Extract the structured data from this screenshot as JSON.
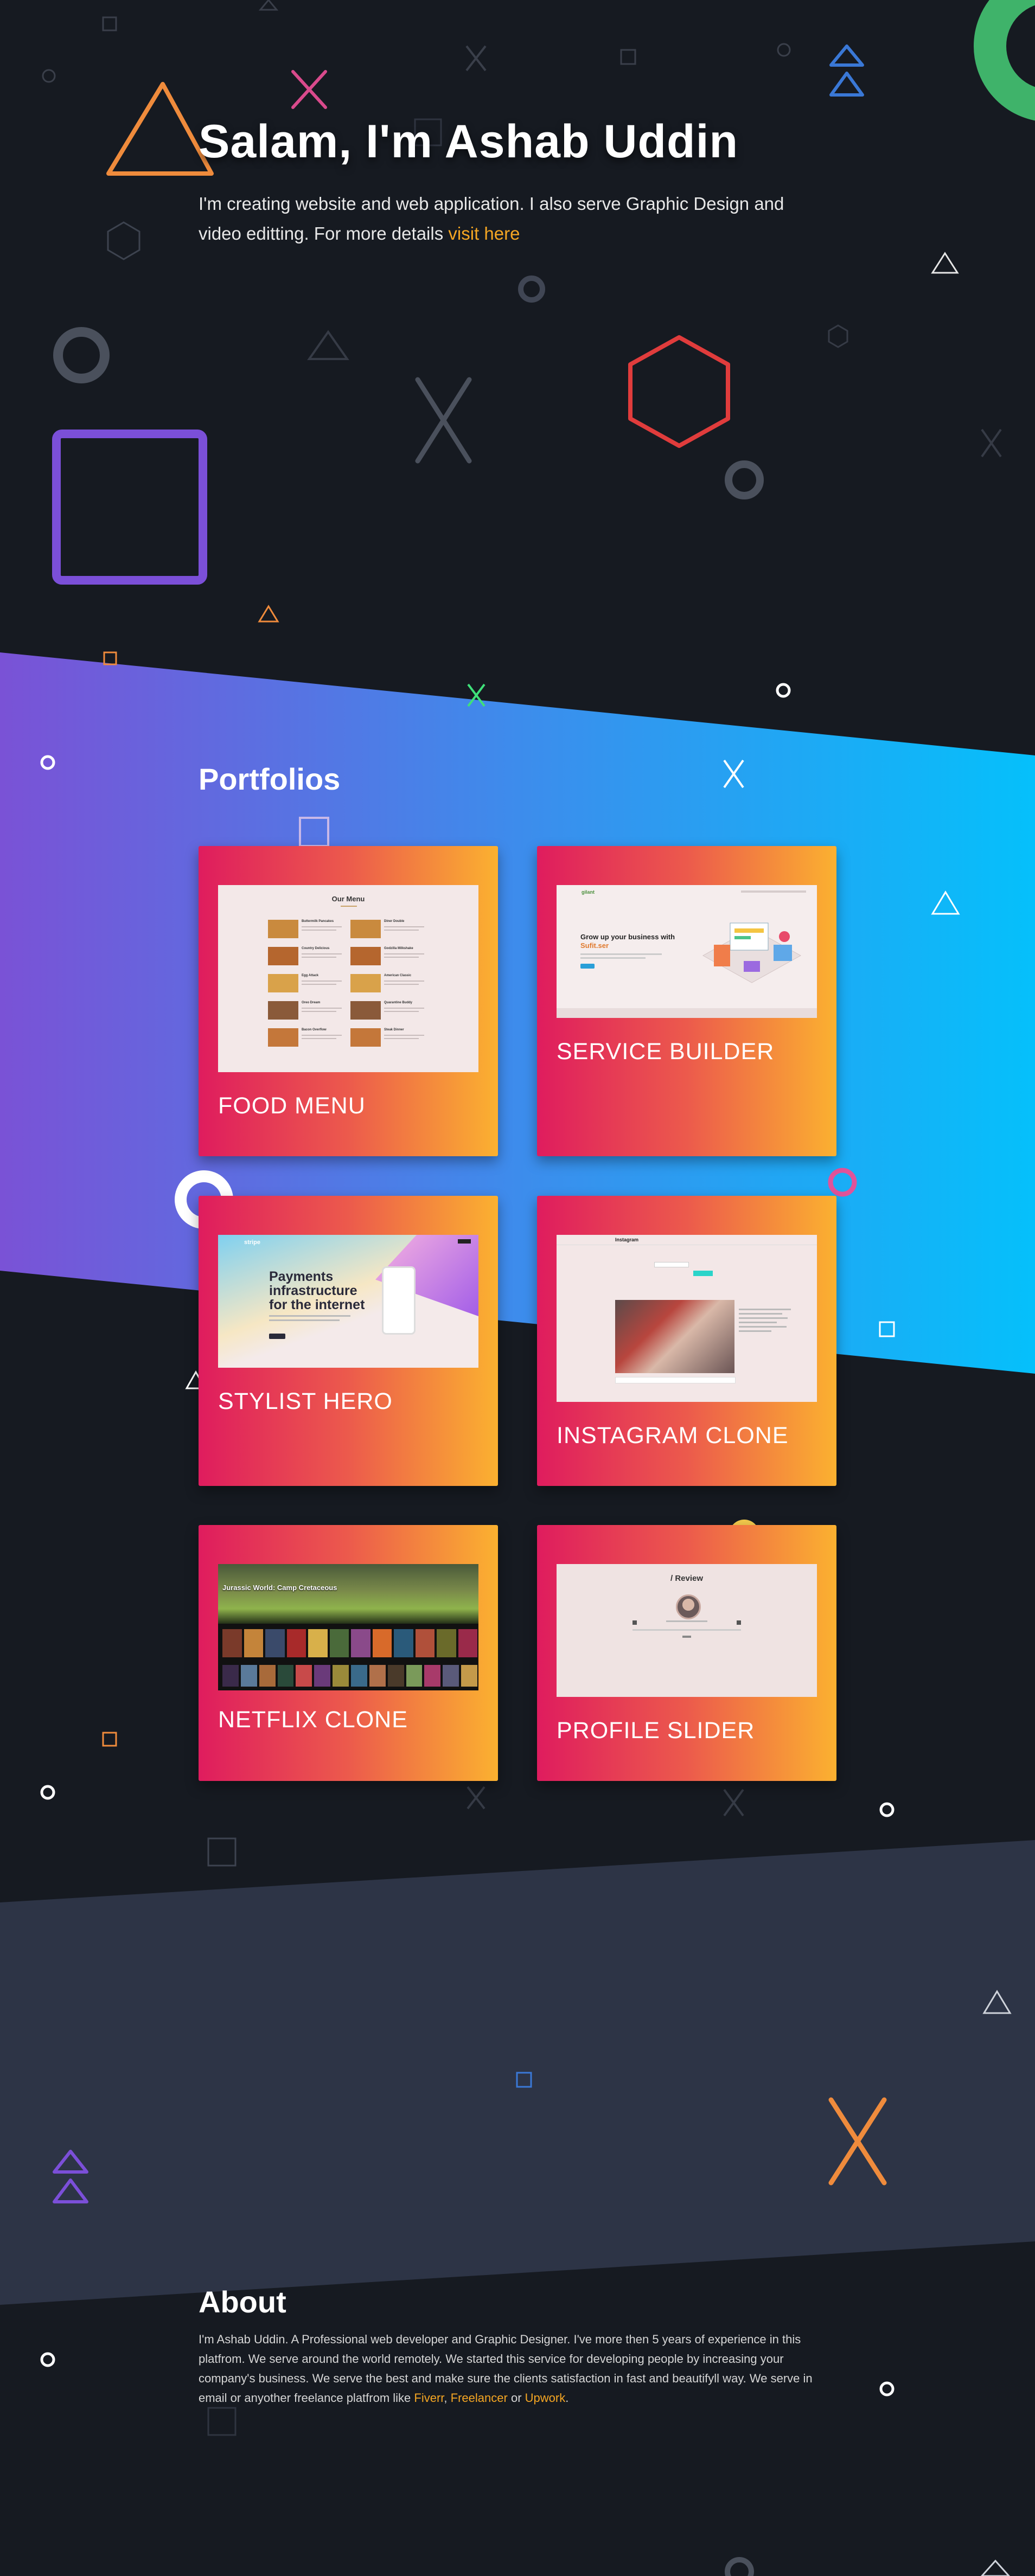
{
  "hero": {
    "title": "Salam, I'm Ashab Uddin",
    "text": "I'm creating website and web application. I also serve Graphic Design and video editting. For more details",
    "link_label": "visit here"
  },
  "portfolios": {
    "title": "Portfolios",
    "items": [
      {
        "label": "FOOD MENU",
        "preview": {
          "heading": "Our Menu",
          "left_items": [
            "Buttermilk Pancakes",
            "Country Delicious",
            "Egg Attack",
            "Oreo Dream",
            "Bacon Overflow"
          ],
          "right_items": [
            "Diner Double",
            "Godzilla Milkshake",
            "American Classic",
            "Quarantine Buddy",
            "Steak Dinner"
          ]
        }
      },
      {
        "label": "SERVICE BUILDER",
        "preview": {
          "logo": "gilant",
          "headline": "Grow up your business with",
          "headline_accent": "Sufit.ser"
        }
      },
      {
        "label": "STYLIST HERO",
        "preview": {
          "logo": "stripe",
          "headline_1": "Payments",
          "headline_2": "infrastructure",
          "headline_3": "for the internet"
        }
      },
      {
        "label": "INSTAGRAM CLONE",
        "preview": {
          "logo": "Instagram"
        }
      },
      {
        "label": "NETFLIX CLONE",
        "preview": {
          "banner_title": "Jurassic World: Camp Cretaceous"
        }
      },
      {
        "label": "PROFILE SLIDER",
        "preview": {
          "heading": "/ Review"
        }
      }
    ]
  },
  "about": {
    "title": "About",
    "text": "I'm Ashab Uddin. A Professional web developer and Graphic Designer. I've more then 5 years of experience in this platfrom. We serve around the world remotely. We started this service for developing people by increasing your company's business. We serve the best and make sure the clients satisfaction in fast and beautifyll way. We serve in email or anyother freelance platfrom like",
    "links": [
      "Fiverr",
      "Freelancer",
      "Upwork"
    ],
    "separator": ",",
    "conjunction": "or",
    "end": "."
  },
  "colors": {
    "background": "#161a21",
    "band_start": "#7a52d6",
    "band_end": "#05c0fb",
    "slate_band": "#2d3446",
    "accent": "#f5a623",
    "card_start": "#df1c5e",
    "card_end": "#fbb130"
  }
}
